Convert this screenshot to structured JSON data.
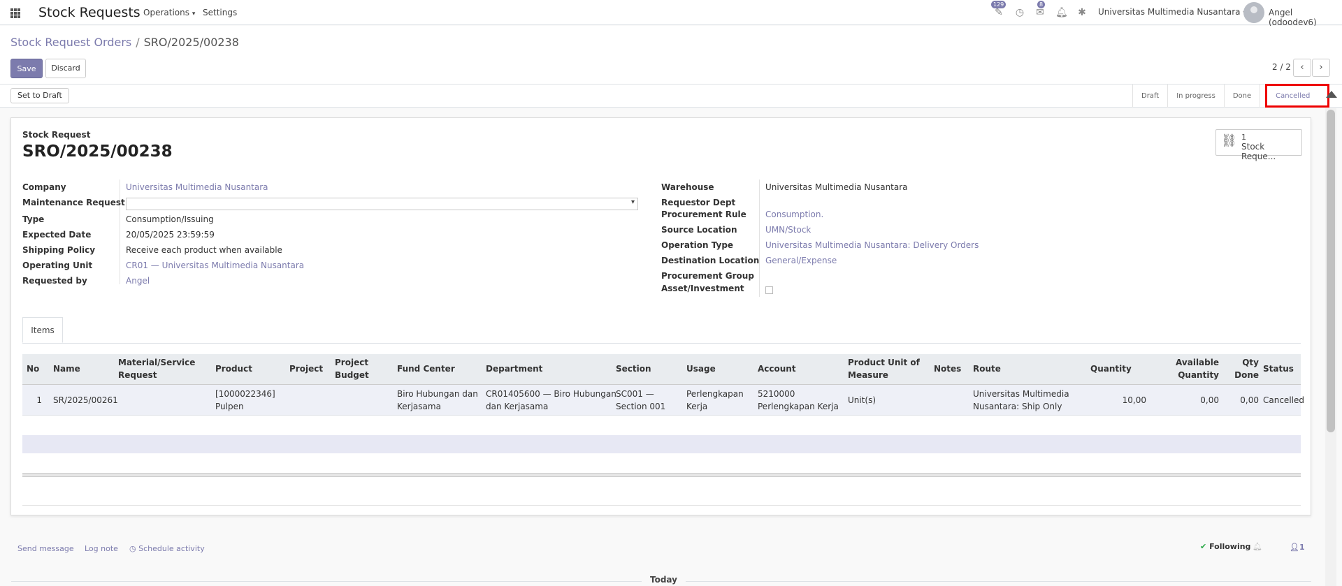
{
  "topbar": {
    "app_title": "Stock Requests",
    "menu_operations": "Operations",
    "menu_settings": "Settings",
    "activity_badge": "129",
    "messages_badge": "8",
    "company": "Universitas Multimedia Nusantara",
    "user": "Angel (odoodev6)"
  },
  "control": {
    "breadcrumb_parent": "Stock Request Orders",
    "breadcrumb_current": "SRO/2025/00238",
    "save_label": "Save",
    "discard_label": "Discard",
    "pager": "2 / 2"
  },
  "statusbar": {
    "set_to_draft": "Set to Draft",
    "stages": [
      "Draft",
      "In progress",
      "Done",
      "Cancelled"
    ],
    "active_stage": "Cancelled"
  },
  "sheet": {
    "smart_button": {
      "count": "1",
      "label": "Stock Reque..."
    },
    "doc_type": "Stock Request",
    "title": "SRO/2025/00238",
    "left_fields": {
      "company_label": "Company",
      "company_value": "Universitas Multimedia Nusantara",
      "maintenance_label": "Maintenance Request",
      "maintenance_value": "",
      "type_label": "Type",
      "type_value": "Consumption/Issuing",
      "expected_label": "Expected Date",
      "expected_value": "20/05/2025 23:59:59",
      "shipping_label": "Shipping Policy",
      "shipping_value": "Receive each product when available",
      "opunit_label": "Operating Unit",
      "opunit_value": "CR01 — Universitas Multimedia Nusantara",
      "requested_label": "Requested by",
      "requested_value": "Angel"
    },
    "right_fields": {
      "warehouse_label": "Warehouse",
      "warehouse_value": "Universitas Multimedia Nusantara",
      "reqdept_label": "Requestor Dept",
      "procrule_label": "Procurement Rule",
      "procrule_value": "Consumption.",
      "source_label": "Source Location",
      "source_value": "UMN/Stock",
      "optype_label": "Operation Type",
      "optype_value": "Universitas Multimedia Nusantara: Delivery Orders",
      "dest_label": "Destination Location",
      "dest_value": "General/Expense",
      "procgroup_label": "Procurement Group",
      "asset_label": "Asset/Investment"
    },
    "tab_label": "Items",
    "table": {
      "columns": {
        "no": "No",
        "name": "Name",
        "material_1": "Material/Service",
        "material_2": "Request",
        "product": "Product",
        "project": "Project",
        "budget_1": "Project",
        "budget_2": "Budget",
        "fund": "Fund Center",
        "department": "Department",
        "section": "Section",
        "usage": "Usage",
        "account": "Account",
        "uom_1": "Product Unit of",
        "uom_2": "Measure",
        "notes": "Notes",
        "route": "Route",
        "quantity": "Quantity",
        "avail_1": "Available",
        "avail_2": "Quantity",
        "done_1": "Qty",
        "done_2": "Done",
        "status": "Status"
      },
      "rows": [
        {
          "no": "1",
          "name": "SR/2025/00261",
          "product_1": "[1000022346]",
          "product_2": "Pulpen",
          "fund_1": "Biro Hubungan dan",
          "fund_2": "Kerjasama",
          "dept_1": "CR01405600 — Biro Hubungan",
          "dept_2": "dan Kerjasama",
          "section_1": "SC001 —",
          "section_2": "Section 001",
          "usage_1": "Perlengkapan",
          "usage_2": "Kerja",
          "account_1": "5210000",
          "account_2": "Perlengkapan Kerja",
          "uom": "Unit(s)",
          "route_1": "Universitas Multimedia",
          "route_2": "Nusantara: Ship Only",
          "quantity": "10,00",
          "available": "0,00",
          "done": "0,00",
          "status": "Cancelled"
        }
      ]
    }
  },
  "chatter": {
    "send_message": "Send message",
    "log_note": "Log note",
    "schedule_activity": "Schedule activity",
    "following": "Following",
    "followers": "1",
    "today": "Today"
  },
  "colors": {
    "accent": "#7c7bad",
    "highlight": "#e00000"
  }
}
